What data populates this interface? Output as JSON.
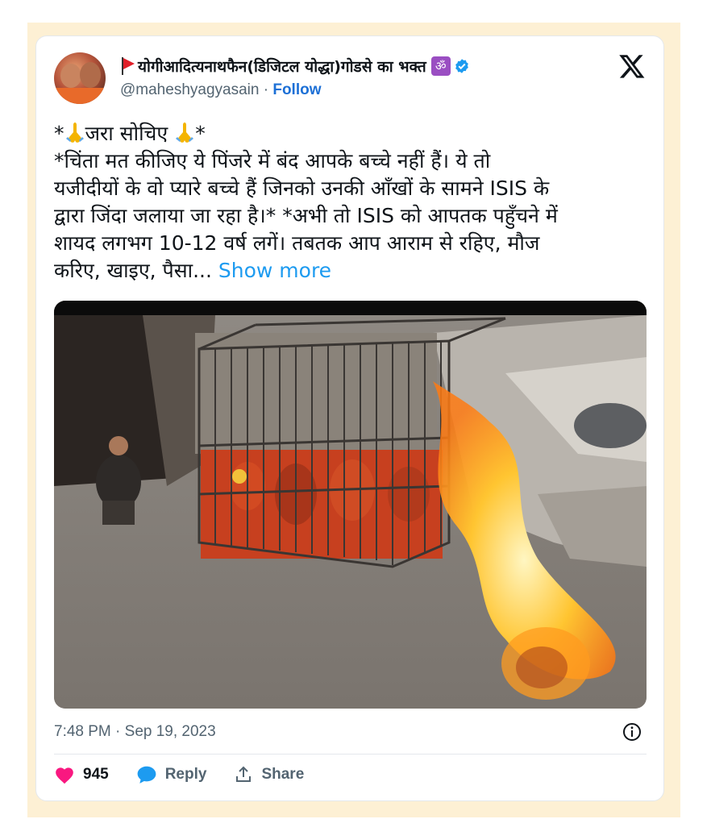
{
  "tweet": {
    "display_name": "योगीआदित्यनाथफैन(डिजिटल योद्धा)गोडसे का भक्त",
    "om_badge": "ॐ",
    "handle": "@maheshyagyasain",
    "separator": " · ",
    "follow_label": "Follow",
    "text_lines": [
      "*",
      "जरा सोचिए",
      "*",
      "*चिंता मत कीजिए ये पिंजरे में बंद आपके बच्चे नहीं हैं। ये तो",
      "यजीदीयों के वो प्यारे बच्चे हैं जिनको उनकी आँखों के सामने ISIS के",
      "द्वारा जिंदा जलाया जा रहा है।* *अभी तो ISIS को आपतक पहुँचने में",
      "शायद लगभग 10-12 वर्ष लगें। तबतक आप आराम से रहिए, मौज",
      "करिए, खाइए, पैसा..."
    ],
    "show_more": "Show more",
    "timestamp": "7:48 PM · Sep 19, 2023",
    "likes": "945",
    "reply_label": "Reply",
    "share_label": "Share"
  },
  "icons": {
    "flag": "red-flag-icon",
    "verified": "verified-badge-icon",
    "x_logo": "x-logo-icon",
    "pray": "folded-hands-icon",
    "info": "info-icon",
    "heart": "heart-icon",
    "reply": "speech-bubble-icon",
    "share": "share-icon"
  },
  "colors": {
    "link": "#1d9bf0",
    "follow": "#1d70d6",
    "like": "#f91880",
    "reply": "#1d9bf0",
    "frame": "#fdf0d4"
  }
}
